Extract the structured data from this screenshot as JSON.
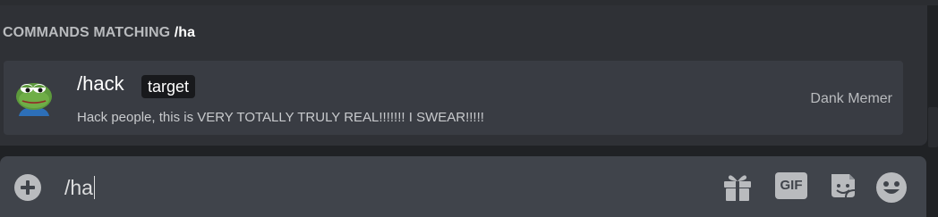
{
  "autocomplete": {
    "header_label": "COMMANDS MATCHING",
    "header_query": "/ha",
    "command": {
      "name": "/hack",
      "option": "target",
      "description": "Hack people, this is VERY TOTALLY TRULY REAL!!!!!!! I SWEAR!!!!!",
      "app": "Dank Memer",
      "avatar_icon": "pepe-frog-avatar"
    }
  },
  "chatbar": {
    "input_value": "/ha",
    "buttons": {
      "upload_icon": "plus-circle-icon",
      "gift_icon": "gift-icon",
      "gif_label": "GIF",
      "sticker_icon": "sticker-icon",
      "emoji_icon": "smiley-icon"
    }
  },
  "colors": {
    "background": "#202225",
    "popup": "#2f3136",
    "row_selected": "#393c43",
    "chatbar": "#40444b",
    "text_muted": "#b9bbbe"
  }
}
